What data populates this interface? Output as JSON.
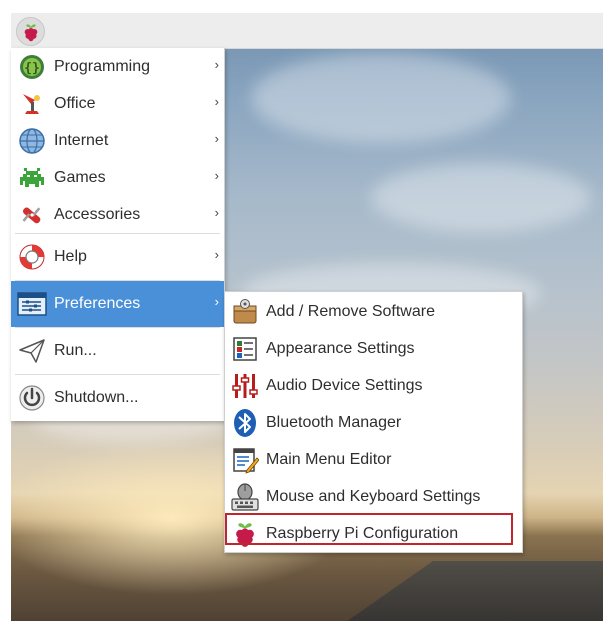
{
  "panel": {
    "menu_button_icon": "raspberry-icon"
  },
  "menu": {
    "items": [
      {
        "label": "Programming",
        "icon": "programming-icon",
        "has_submenu": true
      },
      {
        "label": "Office",
        "icon": "office-icon",
        "has_submenu": true
      },
      {
        "label": "Internet",
        "icon": "globe-icon",
        "has_submenu": true
      },
      {
        "label": "Games",
        "icon": "games-icon",
        "has_submenu": true
      },
      {
        "label": "Accessories",
        "icon": "accessories-icon",
        "has_submenu": true
      },
      {
        "label": "Help",
        "icon": "lifebuoy-icon",
        "has_submenu": true
      },
      {
        "label": "Preferences",
        "icon": "preferences-icon",
        "has_submenu": true,
        "selected": true
      },
      {
        "label": "Run...",
        "icon": "paper-plane-icon",
        "has_submenu": false
      },
      {
        "label": "Shutdown...",
        "icon": "power-icon",
        "has_submenu": false
      }
    ],
    "arrow_glyph": "›"
  },
  "submenu": {
    "items": [
      {
        "label": "Add / Remove Software",
        "icon": "package-icon"
      },
      {
        "label": "Appearance Settings",
        "icon": "appearance-icon"
      },
      {
        "label": "Audio Device Settings",
        "icon": "audio-sliders-icon"
      },
      {
        "label": "Bluetooth Manager",
        "icon": "bluetooth-icon"
      },
      {
        "label": "Main Menu Editor",
        "icon": "menu-editor-icon"
      },
      {
        "label": "Mouse and Keyboard Settings",
        "icon": "mouse-keyboard-icon"
      },
      {
        "label": "Raspberry Pi Configuration",
        "icon": "raspberry-icon",
        "highlighted": true
      }
    ]
  },
  "colors": {
    "selected_bg": "#4a90d9",
    "highlight_border": "#c0272d",
    "raspberry_red": "#c51a4a",
    "raspberry_leaf": "#6cc04a"
  }
}
